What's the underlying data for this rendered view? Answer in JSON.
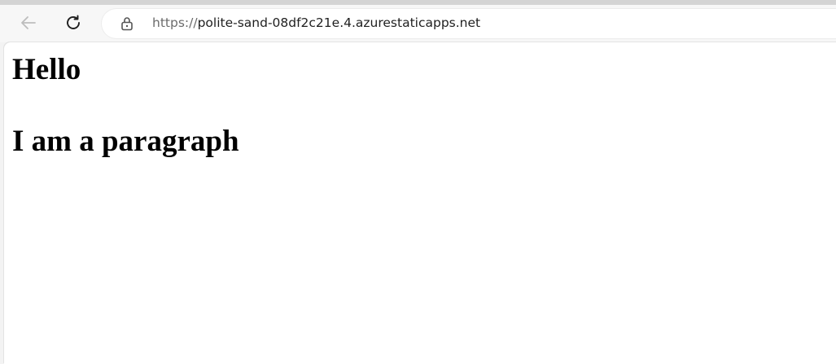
{
  "browser": {
    "back_icon": "arrow-left-icon",
    "reload_icon": "reload-icon",
    "lock_icon": "lock-icon",
    "url_scheme": "https://",
    "url_host": "polite-sand-08df2c21e.4.azurestaticapps.net"
  },
  "page": {
    "heading": "Hello",
    "paragraph": "I am a paragraph"
  },
  "colors": {
    "toolbar_bg": "#f7f7f7",
    "content_bg": "#ffffff",
    "text": "#000000"
  }
}
